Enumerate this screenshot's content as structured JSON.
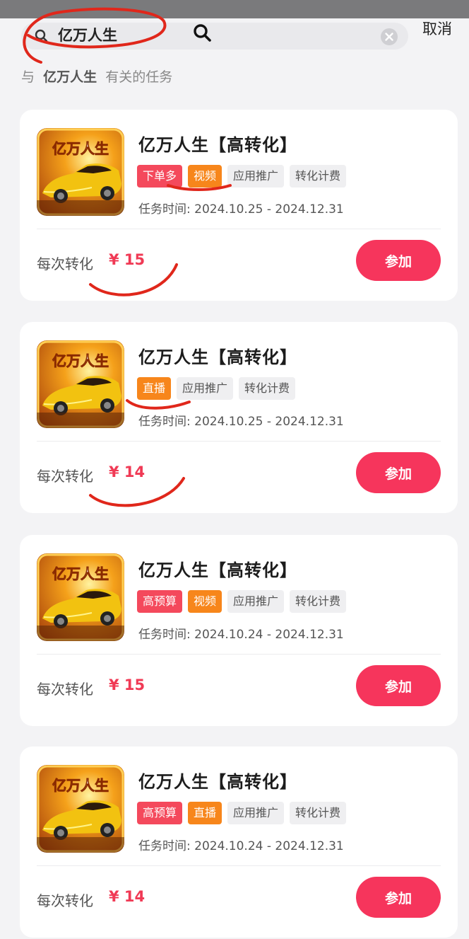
{
  "search": {
    "query": "亿万人生",
    "cancel_label": "取消"
  },
  "related": {
    "prefix": "与",
    "keyword": "亿万人生",
    "suffix": "有关的任务"
  },
  "thumbnail_text": "亿万人生",
  "tasks": [
    {
      "title": "亿万人生【高转化】",
      "tags": [
        {
          "label": "下单多",
          "color": "red"
        },
        {
          "label": "视频",
          "color": "orange"
        },
        {
          "label": "应用推广",
          "color": "gray"
        },
        {
          "label": "转化计费",
          "color": "gray"
        }
      ],
      "dates": "任务时间: 2024.10.25 - 2024.12.31",
      "price_label": "每次转化",
      "price": "¥ 15",
      "join_label": "参加"
    },
    {
      "title": "亿万人生【高转化】",
      "tags": [
        {
          "label": "直播",
          "color": "orange"
        },
        {
          "label": "应用推广",
          "color": "gray"
        },
        {
          "label": "转化计费",
          "color": "gray"
        }
      ],
      "dates": "任务时间: 2024.10.25 - 2024.12.31",
      "price_label": "每次转化",
      "price": "¥ 14",
      "join_label": "参加"
    },
    {
      "title": "亿万人生【高转化】",
      "tags": [
        {
          "label": "高预算",
          "color": "red"
        },
        {
          "label": "视频",
          "color": "orange"
        },
        {
          "label": "应用推广",
          "color": "gray"
        },
        {
          "label": "转化计费",
          "color": "gray"
        }
      ],
      "dates": "任务时间: 2024.10.24 - 2024.12.31",
      "price_label": "每次转化",
      "price": "¥ 15",
      "join_label": "参加"
    },
    {
      "title": "亿万人生【高转化】",
      "tags": [
        {
          "label": "高预算",
          "color": "red"
        },
        {
          "label": "直播",
          "color": "orange"
        },
        {
          "label": "应用推广",
          "color": "gray"
        },
        {
          "label": "转化计费",
          "color": "gray"
        }
      ],
      "dates": "任务时间: 2024.10.24 - 2024.12.31",
      "price_label": "每次转化",
      "price": "¥ 14",
      "join_label": "参加"
    }
  ],
  "colors": {
    "accent": "#f6355c",
    "tag_red": "#f4495c",
    "tag_orange": "#f7861b",
    "tag_gray": "#efeff1",
    "price": "#f03a55",
    "annotation": "#e0271b"
  }
}
